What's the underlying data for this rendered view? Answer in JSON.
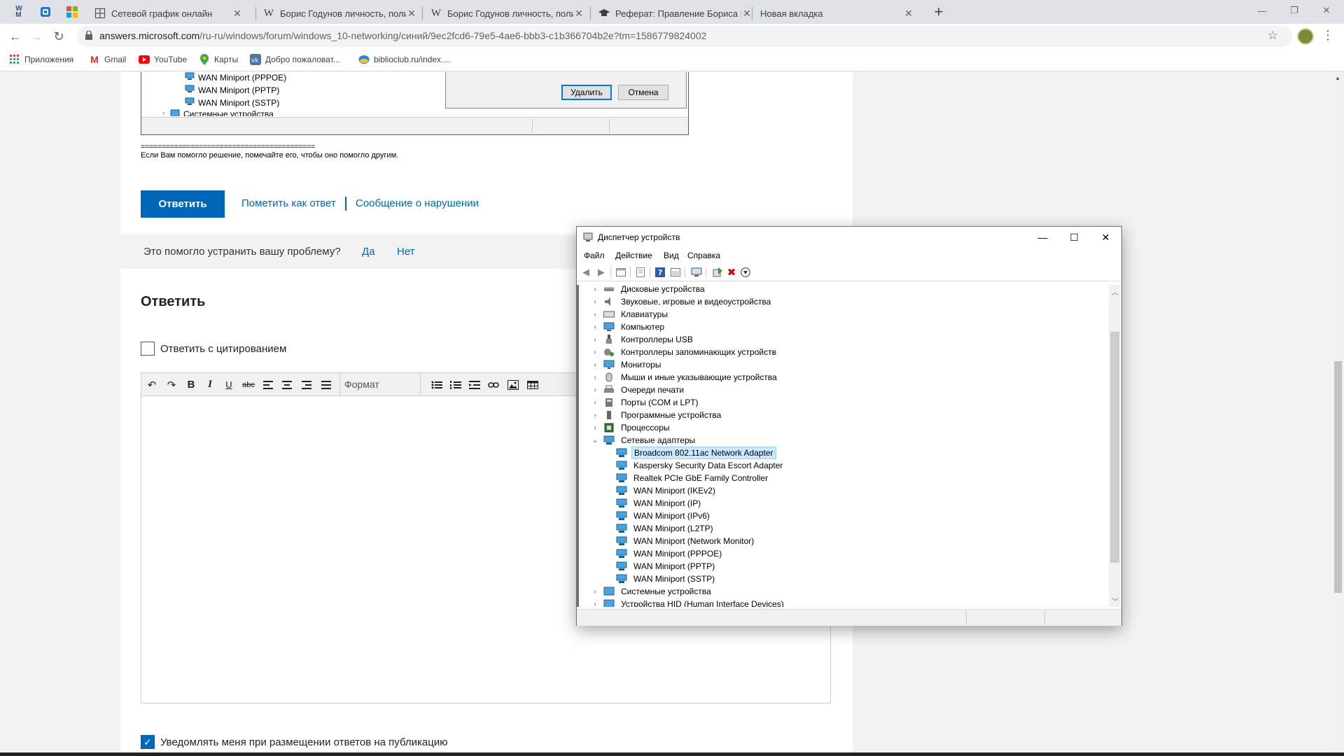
{
  "tabs": [
    {
      "title": "Сетевой график онлайн",
      "active": false
    },
    {
      "title": "Борис Годунов личность, полит",
      "active": false
    },
    {
      "title": "Борис Годунов личность, полит",
      "active": false
    },
    {
      "title": "Реферат: Правление Бориса Го",
      "active": false
    },
    {
      "title": "Новая вкладка",
      "active": false
    }
  ],
  "address": {
    "url_host": "answers.microsoft.com",
    "url_path": "/ru-ru/windows/forum/windows_10-networking/синий/9ec2fcd6-79e5-4ae6-bbb3-c1b366704b2e?tm=1586779824002"
  },
  "bookmarks": [
    "Приложения",
    "Gmail",
    "YouTube",
    "Карты",
    "Добро пожаловат...",
    "biblioclub.ru/index...."
  ],
  "embedded_screenshot": {
    "rows": [
      "WAN Miniport (PPPOE)",
      "WAN Miniport (PPTP)",
      "WAN Miniport (SSTP)",
      "Системные устройства"
    ],
    "delete_label": "Удалить",
    "cancel_label": "Отмена"
  },
  "post": {
    "separator": "==========================================",
    "signature": "Если Вам помогло решение, помечайте его, чтобы оно помогло другим.",
    "reply_button": "Ответить",
    "mark_answer": "Пометить как ответ",
    "report_abuse": "Сообщение о нарушении",
    "helpful_question": "Это помогло устранить вашу проблему?",
    "yes": "Да",
    "no": "Нет"
  },
  "reply_form": {
    "heading": "Ответить",
    "quote_label": "Ответить с цитированием",
    "quote_checked": false,
    "format_label": "Формат",
    "notify_label": "Уведомлять меня при размещении ответов на публикацию",
    "notify_checked": true
  },
  "device_manager": {
    "title": "Диспетчер устройств",
    "menu": [
      "Файл",
      "Действие",
      "Вид",
      "Справка"
    ],
    "categories_before": [
      "Дисковые устройства",
      "Звуковые, игровые и видеоустройства",
      "Клавиатуры",
      "Компьютер",
      "Контроллеры USB",
      "Контроллеры запоминающих устройств",
      "Мониторы",
      "Мыши и иные указывающие устройства",
      "Очереди печати",
      "Порты (COM и LPT)",
      "Программные устройства",
      "Процессоры"
    ],
    "expanded_category": "Сетевые адаптеры",
    "adapters": [
      "Broadcom 802.11ac Network Adapter",
      "Kaspersky Security Data Escort Adapter",
      "Realtek PCIe GbE Family Controller",
      "WAN Miniport (IKEv2)",
      "WAN Miniport (IP)",
      "WAN Miniport (IPv6)",
      "WAN Miniport (L2TP)",
      "WAN Miniport (Network Monitor)",
      "WAN Miniport (PPPOE)",
      "WAN Miniport (PPTP)",
      "WAN Miniport (SSTP)"
    ],
    "selected_adapter": "Broadcom 802.11ac Network Adapter",
    "categories_after": [
      "Системные устройства",
      "Устройства HID (Human Interface Devices)"
    ]
  },
  "colors": {
    "ms_blue": "#0067b8",
    "chrome_strip": "#dee1e6",
    "selection": "#cce8ff"
  }
}
